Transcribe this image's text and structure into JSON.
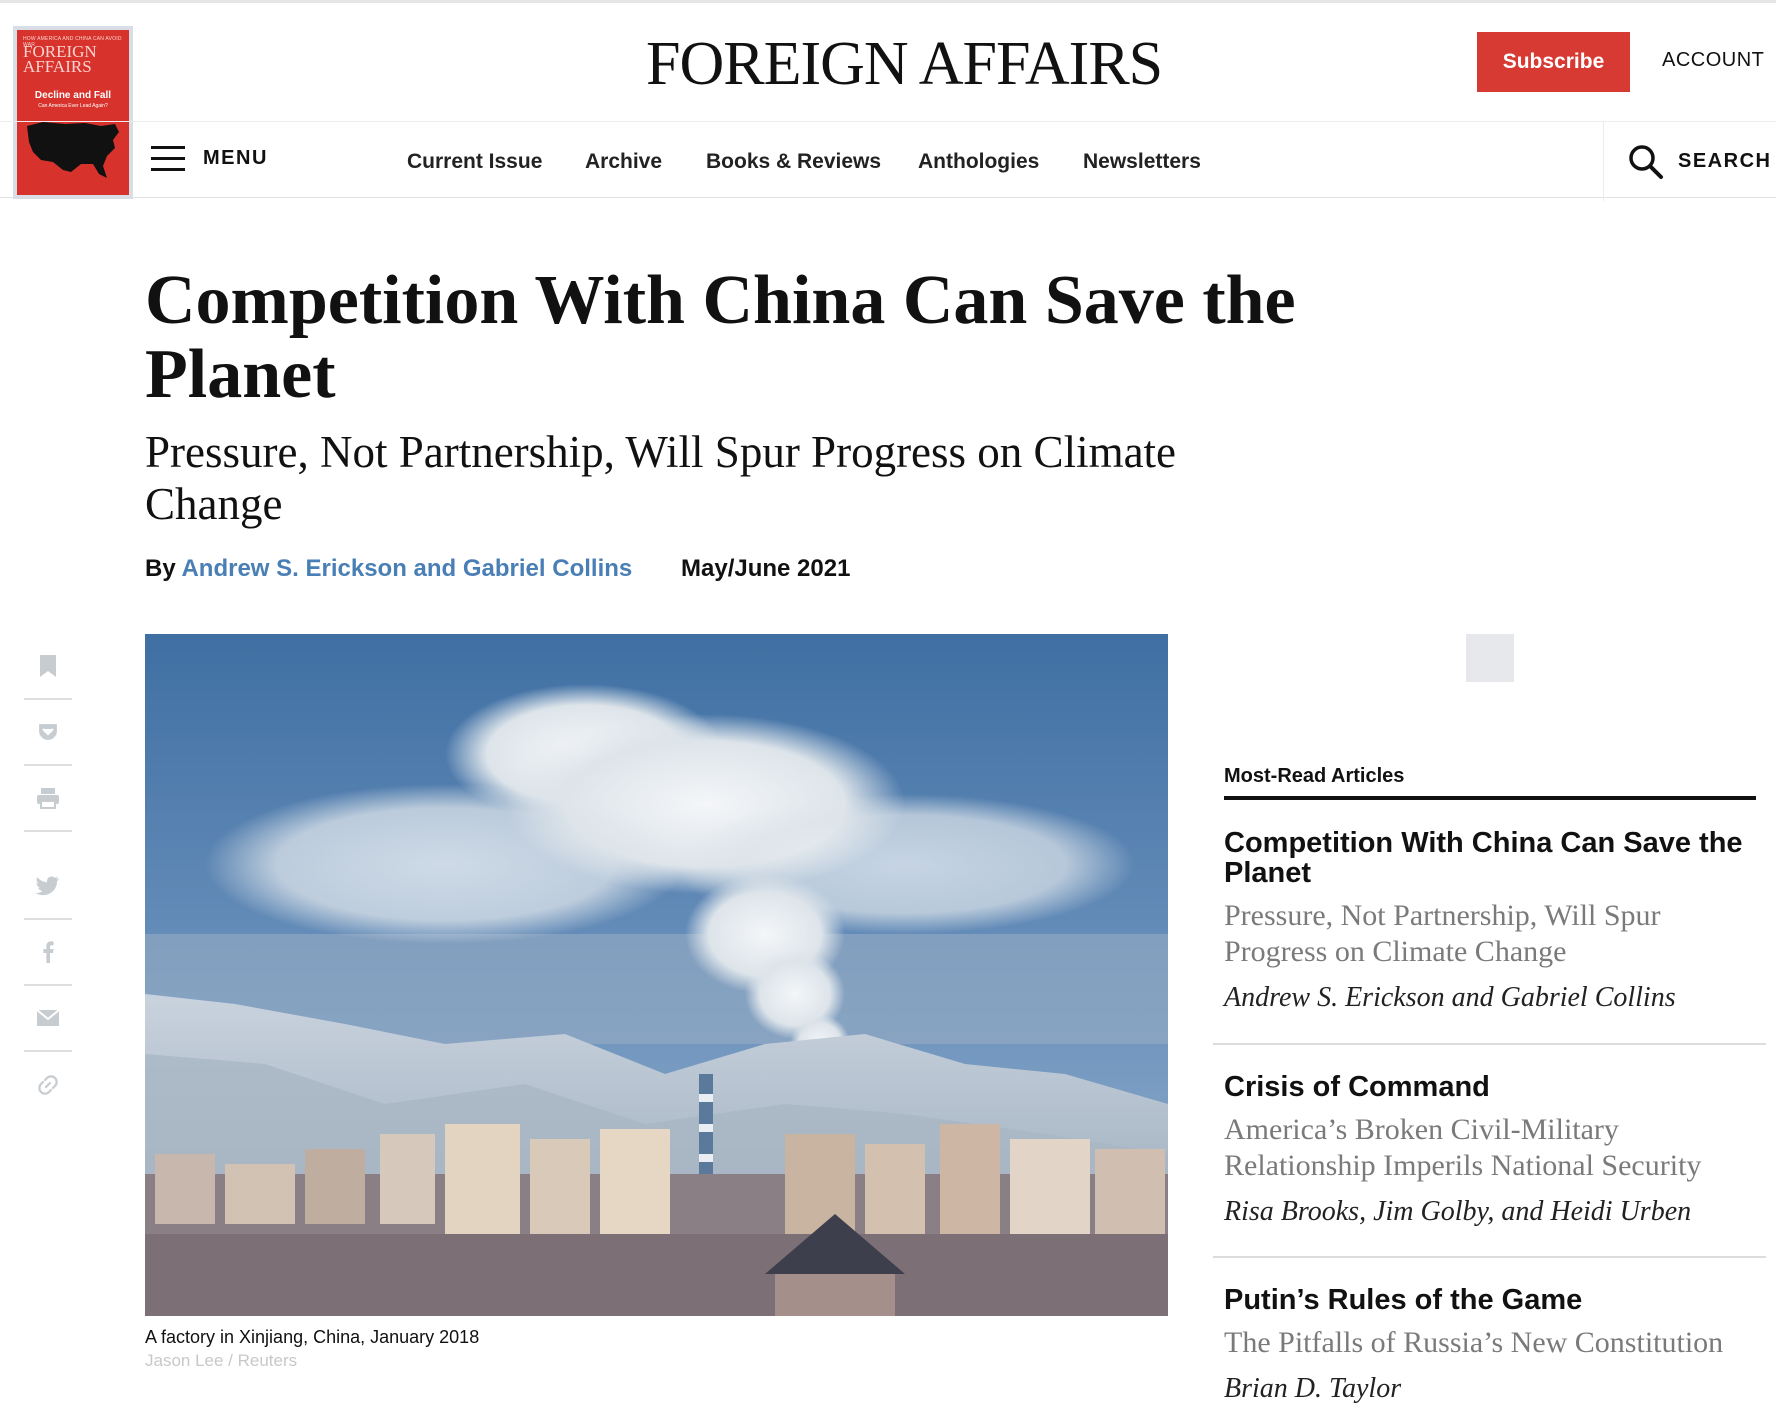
{
  "header": {
    "masthead": "FOREIGN AFFAIRS",
    "subscribe_label": "Subscribe",
    "account_label": "ACCOUNT",
    "cover": {
      "kicker": "HOW AMERICA AND CHINA CAN AVOID WAR",
      "masthead": "FOREIGN AFFAIRS",
      "title": "Decline and Fall",
      "subtitle": "Can America Ever Lead Again?"
    }
  },
  "nav": {
    "menu_label": "MENU",
    "items": [
      {
        "label": "Current Issue"
      },
      {
        "label": "Archive"
      },
      {
        "label": "Books & Reviews"
      },
      {
        "label": "Anthologies"
      },
      {
        "label": "Newsletters"
      }
    ],
    "search_label": "SEARCH"
  },
  "article": {
    "title": "Competition With China Can Save the Planet",
    "dek": "Pressure, Not Partnership, Will Spur Progress on Climate Change",
    "by_prefix": "By",
    "authors": "Andrew S. Erickson and Gabriel Collins",
    "issue_date": "May/June 2021",
    "image_caption": "A factory in Xinjiang, China, January 2018",
    "image_credit": "Jason Lee / Reuters"
  },
  "share_rail": {
    "icons": [
      "bookmark-icon",
      "pocket-icon",
      "print-icon",
      "twitter-icon",
      "facebook-icon",
      "email-icon",
      "link-icon"
    ]
  },
  "sidebar": {
    "most_read_heading": "Most-Read Articles",
    "articles": [
      {
        "title": "Competition With China Can Save the Planet",
        "dek": "Pressure, Not Partnership, Will Spur Progress on Climate Change",
        "author": "Andrew S. Erickson and Gabriel Collins"
      },
      {
        "title": "Crisis of Command",
        "dek": "America’s Broken Civil-Military Relationship Imperils National Security",
        "author": "Risa Brooks, Jim Golby, and Heidi Urben"
      },
      {
        "title": "Putin’s Rules of the Game",
        "dek": "The Pitfalls of Russia’s New Constitution",
        "author": "Brian D. Taylor"
      }
    ]
  },
  "colors": {
    "brand_red": "#d63a32",
    "author_link_blue": "#4a7fb5",
    "cover_red": "#d7332c"
  }
}
